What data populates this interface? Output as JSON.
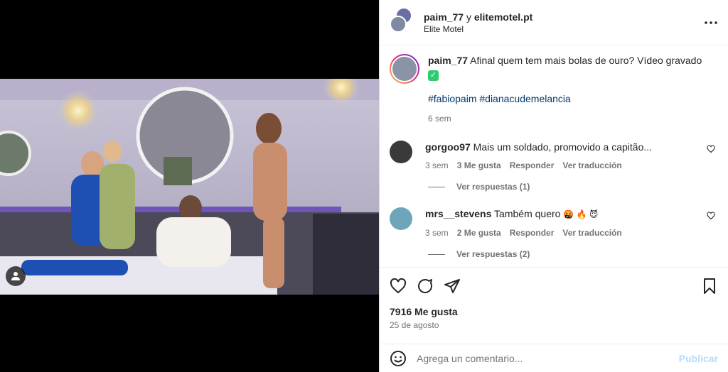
{
  "header": {
    "user": "paim_77",
    "joiner": "y",
    "collaborator": "elitemotel.pt",
    "location": "Elite Motel",
    "more_icon": "more-horizontal-icon"
  },
  "caption": {
    "user": "paim_77",
    "text": "Afinal quem tem mais bolas de ouro? Vídeo gravado",
    "emoji": "✓",
    "hashtags": "#fabiopaim #dianacudemelancia",
    "time": "6 sem"
  },
  "comments": [
    {
      "user": "gorgoo97",
      "text": "Mais um soldado, promovido a capitão...",
      "time": "3 sem",
      "likes": "3 Me gusta",
      "reply": "Responder",
      "translate": "Ver traducción",
      "view_replies": "Ver respuestas (1)"
    },
    {
      "user": "mrs__stevens",
      "text": "Também quero",
      "emojis": "🤬 🔥 😈",
      "time": "3 sem",
      "likes": "2 Me gusta",
      "reply": "Responder",
      "translate": "Ver traducción",
      "view_replies": "Ver respuestas (2)"
    }
  ],
  "actions": {
    "likes": "7916 Me gusta",
    "date": "25 de agosto"
  },
  "add_comment": {
    "placeholder": "Agrega un comentario...",
    "post": "Publicar"
  },
  "colors": {
    "link": "#00376b",
    "muted": "#737373",
    "publish_disabled": "#b3dbff"
  }
}
